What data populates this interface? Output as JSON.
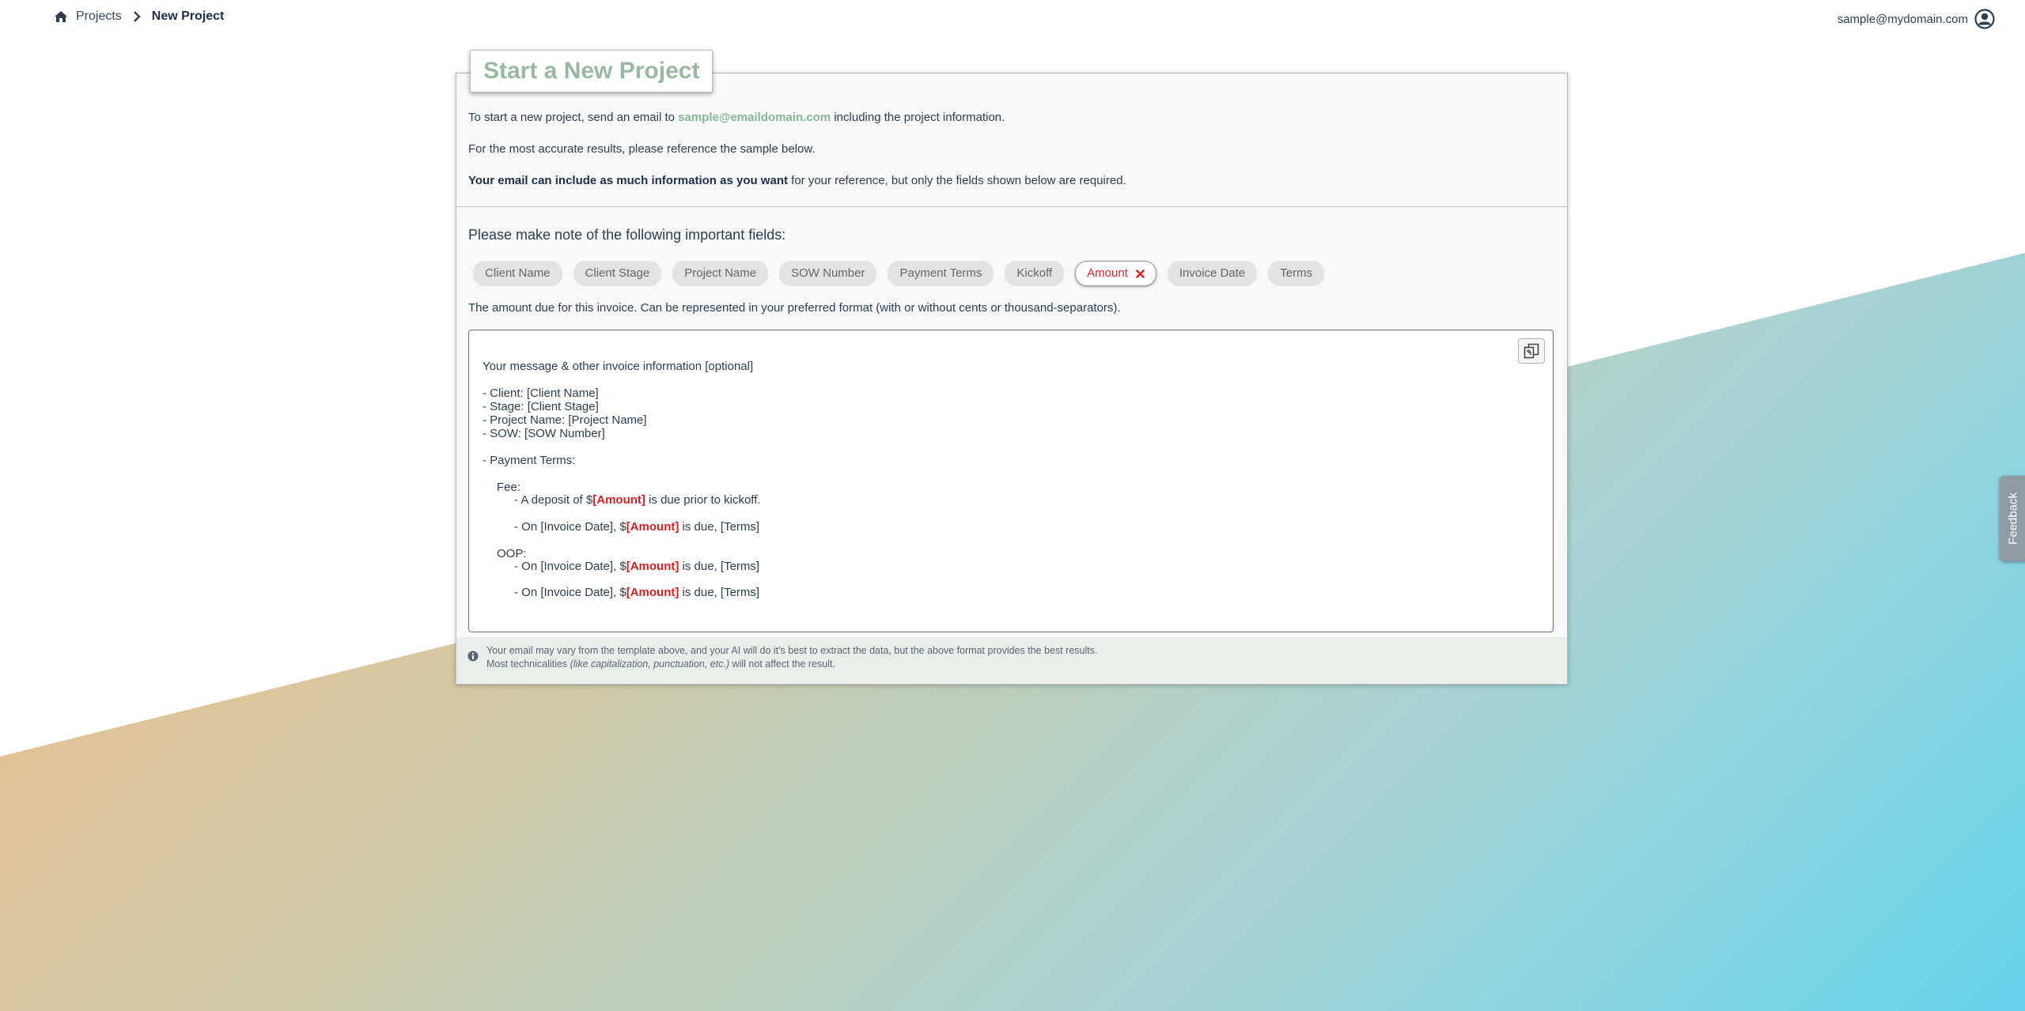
{
  "breadcrumb": {
    "home_icon": "home-icon",
    "projects_label": "Projects",
    "current_label": "New Project"
  },
  "user": {
    "email": "sample@mydomain.com",
    "avatar_icon": "user-circle-icon"
  },
  "card": {
    "title": "Start a New Project",
    "intro": {
      "line1_prefix": "To start a new project, send an email to ",
      "line1_email": "sample@emaildomain.com",
      "line1_suffix": " including the project information.",
      "line2": "For the most accurate results, please reference the sample below.",
      "line3_strong": "Your email can include as much information as you want",
      "line3_rest": " for your reference, but only the fields shown below are required."
    },
    "fields_heading": "Please make note of the following important fields:",
    "fields": [
      "Client Name",
      "Client Stage",
      "Project Name",
      "SOW Number",
      "Payment Terms",
      "Kickoff",
      "Amount",
      "Invoice Date",
      "Terms"
    ],
    "selected_field": "Amount",
    "field_description": "The amount due for this invoice. Can be represented in your preferred format (with or without cents or thousand-separators).",
    "template": {
      "message": "Your message & other invoice information [optional]",
      "client": "- Client: [Client Name]",
      "stage": "- Stage: [Client Stage]",
      "project": "- Project Name: [Project Name]",
      "sow": "- SOW: [SOW Number]",
      "payment_terms": "- Payment Terms:",
      "fee": "Fee:",
      "deposit_prefix": "- A deposit of $",
      "amount_token": "[Amount]",
      "deposit_suffix": " is due prior to kickoff.",
      "on_invoice_prefix": "- On [Invoice Date], $",
      "on_invoice_suffix": " is due, [Terms]",
      "oop": "OOP:"
    },
    "footnote": {
      "line1": "Your email may vary from the template above, and your AI will do it's best to extract the data, but the above format provides the best results.",
      "line2_prefix": "Most technicalities ",
      "line2_italic": "(like capitalization, punctuation, etc.)",
      "line2_suffix": " will not affect the result."
    }
  },
  "feedback_label": "Feedback",
  "colors": {
    "accent_green": "#98b9a0",
    "amount_red": "#d91f1f",
    "text_navy": "#2c3e50"
  }
}
